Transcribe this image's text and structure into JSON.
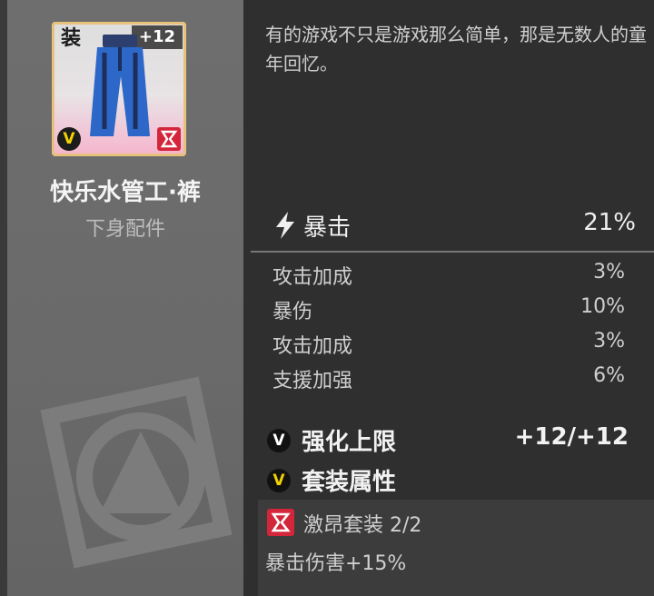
{
  "item": {
    "tag": "装",
    "level": "+12",
    "name": "快乐水管工·裤",
    "type": "下身配件",
    "rarity_badge": "V",
    "card_icon": "pants-icon",
    "set_icon": "set-emblem-icon"
  },
  "description": "有的游戏不只是游戏那么简单，那是无数人的童年回忆。",
  "main_stat": {
    "icon": "lightning-icon",
    "label": "暴击",
    "value": "21%"
  },
  "sub_stats": [
    {
      "label": "攻击加成",
      "value": "3%"
    },
    {
      "label": "暴伤",
      "value": "10%"
    },
    {
      "label": "攻击加成",
      "value": "3%"
    },
    {
      "label": "支援加强",
      "value": "6%"
    }
  ],
  "enhance": {
    "badge": "V",
    "label": "强化上限",
    "value": "+12/+12"
  },
  "set_attr": {
    "badge": "V",
    "label": "套装属性"
  },
  "set_bonus": {
    "name": "激昂套装 2/2",
    "effect": "暴击伤害+15%"
  },
  "colors": {
    "accent_red": "#d4263a",
    "accent_yellow": "#f2d100",
    "card_border": "#e8c27a"
  }
}
